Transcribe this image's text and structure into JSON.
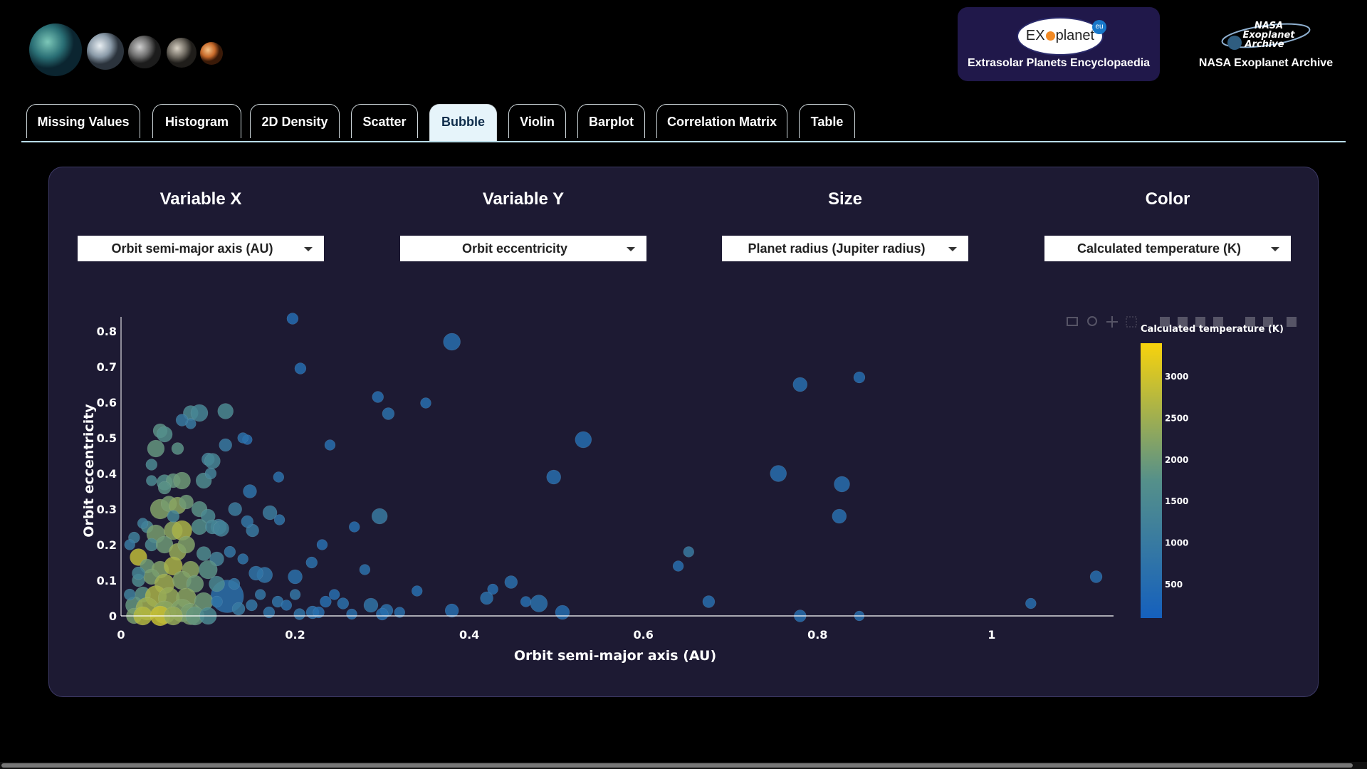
{
  "header": {
    "planets_icon": "planets-strip-icon",
    "brand": {
      "logo_text": "EX",
      "logo_text2": "planet",
      "logo_badge": "eu",
      "label": "Extrasolar Planets Encyclopaedia"
    },
    "nasa": {
      "logo_line1": "NASA",
      "logo_line2": "Exoplanet",
      "logo_line3": "Archive",
      "label": "NASA Exoplanet Archive"
    }
  },
  "tabs": [
    {
      "label": "Missing Values",
      "active": false
    },
    {
      "label": "Histogram",
      "active": false
    },
    {
      "label": "2D Density",
      "active": false
    },
    {
      "label": "Scatter",
      "active": false
    },
    {
      "label": "Bubble",
      "active": true
    },
    {
      "label": "Violin",
      "active": false
    },
    {
      "label": "Barplot",
      "active": false
    },
    {
      "label": "Correlation Matrix",
      "active": false
    },
    {
      "label": "Table",
      "active": false
    }
  ],
  "controls": [
    {
      "title": "Variable X",
      "value": "Orbit semi-major axis (AU)"
    },
    {
      "title": "Variable Y",
      "value": "Orbit eccentricity"
    },
    {
      "title": "Size",
      "value": "Planet radius (Jupiter radius)"
    },
    {
      "title": "Color",
      "value": "Calculated temperature (K)"
    }
  ],
  "colors": {
    "accent": "#e6f4fa",
    "panel": "#1d1a33",
    "low": "#1560bd",
    "mid": "#55908a",
    "high": "#f8d30c"
  },
  "chart_data": {
    "type": "scatter",
    "xlabel": "Orbit semi-major axis (AU)",
    "ylabel": "Orbit eccentricity",
    "xlim": [
      0,
      1.14
    ],
    "ylim": [
      -0.02,
      0.84
    ],
    "x_ticks": [
      0,
      0.2,
      0.4,
      0.6,
      0.8,
      1
    ],
    "x_tick_labels": [
      "0",
      "0.2",
      "0.4",
      "0.6",
      "0.8",
      "1"
    ],
    "y_ticks": [
      0,
      0.1,
      0.2,
      0.3,
      0.4,
      0.5,
      0.6,
      0.7,
      0.8
    ],
    "y_tick_labels": [
      "0",
      "0.1",
      "0.2",
      "0.3",
      "0.4",
      "0.5",
      "0.6",
      "0.7",
      "0.8"
    ],
    "colorbar": {
      "title": "Calculated temperature (K)",
      "range": [
        100,
        3400
      ],
      "ticks": [
        500,
        1000,
        1500,
        2000,
        2500,
        3000
      ],
      "tick_labels": [
        "500",
        "1000",
        "1500",
        "2000",
        "2500",
        "3000"
      ]
    },
    "points": [
      [
        0.197,
        0.835,
        0.5,
        500
      ],
      [
        0.38,
        0.77,
        0.9,
        600
      ],
      [
        0.206,
        0.695,
        0.5,
        550
      ],
      [
        0.295,
        0.615,
        0.5,
        600
      ],
      [
        0.307,
        0.568,
        0.55,
        700
      ],
      [
        0.35,
        0.598,
        0.45,
        600
      ],
      [
        0.531,
        0.495,
        0.85,
        550
      ],
      [
        0.145,
        0.495,
        0.4,
        600
      ],
      [
        0.24,
        0.48,
        0.45,
        600
      ],
      [
        0.497,
        0.39,
        0.7,
        600
      ],
      [
        0.181,
        0.39,
        0.45,
        700
      ],
      [
        0.148,
        0.35,
        0.65,
        750
      ],
      [
        0.297,
        0.28,
        0.8,
        1000
      ],
      [
        0.171,
        0.29,
        0.7,
        1100
      ],
      [
        0.182,
        0.27,
        0.45,
        800
      ],
      [
        0.268,
        0.25,
        0.45,
        600
      ],
      [
        0.231,
        0.2,
        0.45,
        600
      ],
      [
        0.219,
        0.15,
        0.5,
        700
      ],
      [
        0.28,
        0.13,
        0.45,
        700
      ],
      [
        0.2,
        0.11,
        0.7,
        700
      ],
      [
        0.34,
        0.07,
        0.45,
        600
      ],
      [
        0.448,
        0.095,
        0.6,
        650
      ],
      [
        0.427,
        0.075,
        0.45,
        600
      ],
      [
        0.42,
        0.05,
        0.6,
        700
      ],
      [
        0.465,
        0.04,
        0.45,
        600
      ],
      [
        0.48,
        0.035,
        0.9,
        700
      ],
      [
        0.38,
        0.015,
        0.65,
        600
      ],
      [
        0.507,
        0.01,
        0.7,
        550
      ],
      [
        0.305,
        0.015,
        0.6,
        700
      ],
      [
        0.287,
        0.03,
        0.7,
        800
      ],
      [
        0.255,
        0.035,
        0.5,
        700
      ],
      [
        0.245,
        0.06,
        0.45,
        600
      ],
      [
        0.235,
        0.04,
        0.5,
        600
      ],
      [
        0.22,
        0.01,
        0.6,
        700
      ],
      [
        0.205,
        0.005,
        0.5,
        800
      ],
      [
        0.18,
        0.04,
        0.5,
        800
      ],
      [
        0.17,
        0.01,
        0.5,
        800
      ],
      [
        0.15,
        0.03,
        0.5,
        900
      ],
      [
        0.122,
        0.055,
        2.0,
        700
      ],
      [
        0.165,
        0.115,
        0.8,
        800
      ],
      [
        0.155,
        0.12,
        0.7,
        800
      ],
      [
        0.14,
        0.16,
        0.45,
        800
      ],
      [
        0.125,
        0.18,
        0.5,
        900
      ],
      [
        0.112,
        0.25,
        0.8,
        1200
      ],
      [
        0.151,
        0.24,
        0.6,
        1000
      ],
      [
        0.145,
        0.265,
        0.55,
        900
      ],
      [
        0.131,
        0.3,
        0.65,
        1100
      ],
      [
        0.08,
        0.57,
        0.75,
        1500
      ],
      [
        0.09,
        0.57,
        0.9,
        1400
      ],
      [
        0.12,
        0.575,
        0.8,
        1500
      ],
      [
        0.045,
        0.52,
        0.7,
        1800
      ],
      [
        0.05,
        0.51,
        0.8,
        1700
      ],
      [
        0.065,
        0.47,
        0.55,
        1800
      ],
      [
        0.1,
        0.44,
        0.6,
        1300
      ],
      [
        0.105,
        0.435,
        0.8,
        1400
      ],
      [
        0.12,
        0.48,
        0.6,
        1000
      ],
      [
        0.08,
        0.54,
        0.45,
        1000
      ],
      [
        0.04,
        0.47,
        0.9,
        1900
      ],
      [
        0.035,
        0.425,
        0.5,
        1500
      ],
      [
        0.05,
        0.375,
        0.8,
        1700
      ],
      [
        0.06,
        0.38,
        0.7,
        1900
      ],
      [
        0.07,
        0.38,
        0.9,
        2000
      ],
      [
        0.095,
        0.38,
        0.8,
        1600
      ],
      [
        0.103,
        0.4,
        0.5,
        1300
      ],
      [
        0.035,
        0.38,
        0.45,
        1500
      ],
      [
        0.045,
        0.3,
        1.1,
        2200
      ],
      [
        0.055,
        0.315,
        0.8,
        2100
      ],
      [
        0.065,
        0.31,
        0.9,
        2300
      ],
      [
        0.075,
        0.32,
        0.7,
        2000
      ],
      [
        0.09,
        0.3,
        0.8,
        1800
      ],
      [
        0.1,
        0.28,
        0.7,
        1500
      ],
      [
        0.03,
        0.25,
        0.55,
        1500
      ],
      [
        0.04,
        0.23,
        1.0,
        2100
      ],
      [
        0.06,
        0.24,
        1.0,
        2300
      ],
      [
        0.07,
        0.24,
        1.1,
        2600
      ],
      [
        0.09,
        0.25,
        0.8,
        1700
      ],
      [
        0.105,
        0.25,
        0.7,
        1400
      ],
      [
        0.115,
        0.245,
        0.8,
        1300
      ],
      [
        0.035,
        0.2,
        0.6,
        1500
      ],
      [
        0.05,
        0.2,
        0.9,
        2000
      ],
      [
        0.065,
        0.18,
        0.9,
        2400
      ],
      [
        0.075,
        0.2,
        0.9,
        2200
      ],
      [
        0.095,
        0.175,
        0.7,
        1600
      ],
      [
        0.11,
        0.16,
        0.7,
        1300
      ],
      [
        0.02,
        0.165,
        0.9,
        2800
      ],
      [
        0.03,
        0.14,
        0.7,
        2000
      ],
      [
        0.045,
        0.13,
        0.9,
        2200
      ],
      [
        0.06,
        0.14,
        1.0,
        2600
      ],
      [
        0.08,
        0.13,
        0.9,
        2300
      ],
      [
        0.1,
        0.13,
        1.0,
        1800
      ],
      [
        0.02,
        0.1,
        0.6,
        1600
      ],
      [
        0.035,
        0.11,
        0.8,
        2100
      ],
      [
        0.05,
        0.09,
        1.1,
        2500
      ],
      [
        0.07,
        0.1,
        1.0,
        2200
      ],
      [
        0.085,
        0.09,
        0.9,
        2000
      ],
      [
        0.11,
        0.09,
        0.8,
        1500
      ],
      [
        0.025,
        0.06,
        0.8,
        1800
      ],
      [
        0.04,
        0.055,
        1.2,
        2600
      ],
      [
        0.055,
        0.05,
        1.2,
        2400
      ],
      [
        0.075,
        0.05,
        1.1,
        2300
      ],
      [
        0.095,
        0.04,
        1.0,
        2000
      ],
      [
        0.015,
        0.03,
        0.9,
        1900
      ],
      [
        0.03,
        0.02,
        1.3,
        2500
      ],
      [
        0.05,
        0.01,
        1.3,
        2300
      ],
      [
        0.07,
        0.015,
        1.3,
        2200
      ],
      [
        0.08,
        0.005,
        1.2,
        2100
      ],
      [
        0.015,
        0.0,
        0.8,
        2100
      ],
      [
        0.025,
        0.0,
        1.0,
        2700
      ],
      [
        0.045,
        0.0,
        1.1,
        2900
      ],
      [
        0.06,
        0.0,
        1.0,
        2400
      ],
      [
        0.085,
        0.0,
        1.0,
        1900
      ],
      [
        0.1,
        0.0,
        0.9,
        1500
      ],
      [
        0.025,
        0.26,
        0.45,
        1200
      ],
      [
        0.05,
        0.36,
        0.6,
        1800
      ],
      [
        0.06,
        0.28,
        0.55,
        1400
      ],
      [
        0.755,
        0.4,
        0.85,
        600
      ],
      [
        0.78,
        0.65,
        0.7,
        600
      ],
      [
        0.848,
        0.67,
        0.5,
        550
      ],
      [
        0.828,
        0.37,
        0.8,
        600
      ],
      [
        0.825,
        0.28,
        0.7,
        600
      ],
      [
        0.652,
        0.18,
        0.45,
        1000
      ],
      [
        0.64,
        0.14,
        0.45,
        600
      ],
      [
        0.675,
        0.04,
        0.55,
        600
      ],
      [
        0.78,
        0.0,
        0.55,
        600
      ],
      [
        0.848,
        0.0,
        0.4,
        600
      ],
      [
        1.045,
        0.035,
        0.45,
        600
      ],
      [
        1.12,
        0.11,
        0.55,
        600
      ],
      [
        0.14,
        0.5,
        0.45,
        700
      ],
      [
        0.07,
        0.55,
        0.55,
        1000
      ],
      [
        0.11,
        0.04,
        0.5,
        800
      ],
      [
        0.13,
        0.09,
        0.5,
        900
      ],
      [
        0.135,
        0.02,
        0.6,
        1000
      ],
      [
        0.16,
        0.06,
        0.45,
        900
      ],
      [
        0.19,
        0.03,
        0.45,
        700
      ],
      [
        0.2,
        0.06,
        0.45,
        900
      ],
      [
        0.227,
        0.01,
        0.5,
        600
      ],
      [
        0.265,
        0.005,
        0.45,
        650
      ],
      [
        0.3,
        0.005,
        0.55,
        600
      ],
      [
        0.32,
        0.01,
        0.45,
        650
      ],
      [
        0.015,
        0.22,
        0.5,
        1200
      ],
      [
        0.02,
        0.12,
        0.6,
        1400
      ],
      [
        0.01,
        0.06,
        0.5,
        1200
      ],
      [
        0.01,
        0.2,
        0.45,
        1000
      ]
    ]
  }
}
